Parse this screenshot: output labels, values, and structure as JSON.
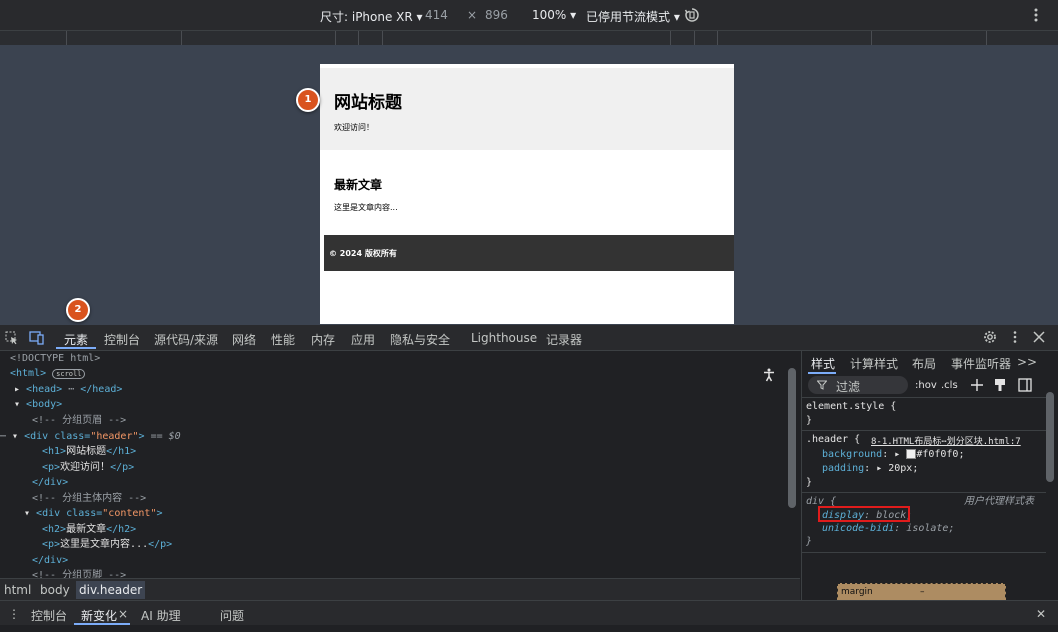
{
  "device_toolbar": {
    "dimensions_label": "尺寸: iPhone XR ▾",
    "width": "414",
    "times": "×",
    "height": "896",
    "zoom": "100% ▾",
    "throttle": "已停用节流模式 ▾"
  },
  "device_page": {
    "header_title": "网站标题",
    "header_text": "欢迎访问！",
    "article_title": "最新文章",
    "article_text": "这里是文章内容...",
    "footer_text": "© 2024 版权所有"
  },
  "badges": {
    "one": "1",
    "two": "2"
  },
  "devtools_tabs": [
    "元素",
    "控制台",
    "源代码/来源",
    "网络",
    "性能",
    "内存",
    "应用",
    "隐私与安全",
    "Lighthouse",
    "记录器"
  ],
  "elements_tree": {
    "doctype": "<!DOCTYPE html>",
    "html_open": "<html>",
    "scroll_badge": "scroll",
    "head": "<head>",
    "head_close": "</head>",
    "body_open": "<body>",
    "comment_header": "<!-- 分组页眉 -->",
    "div_header_tag": "<div class=",
    "div_header_class": "\"header\"",
    "selected_marker": "== $0",
    "h1_open": "<h1>",
    "h1_text": "网站标题",
    "h1_close": "</h1>",
    "p_open": "<p>",
    "p_text": "欢迎访问！",
    "p_close": "</p>",
    "div_close": "</div>",
    "comment_content": "<!-- 分组主体内容 -->",
    "div_content_class": "\"content\"",
    "h2_open": "<h2>",
    "h2_text": "最新文章",
    "h2_close": "</h2>",
    "p2_text": "这里是文章内容...",
    "comment_footer": "<!-- 分组页脚 -->"
  },
  "breadcrumbs": [
    "html",
    "body",
    "div.header"
  ],
  "styles_tabs": [
    "样式",
    "计算样式",
    "布局",
    "事件监听器",
    ">>"
  ],
  "styles": {
    "filter_placeholder": "过滤",
    "hov": ":hov",
    "cls": ".cls",
    "element_style": "element.style {",
    "close_brace": "}",
    "header_selector": ".header {",
    "header_source": "8-1.HTML布局标⋯划分区块.html:7",
    "background_prop": "background",
    "background_value": "#f0f0f0;",
    "padding_prop": "padding",
    "padding_value": "20px;",
    "div_selector": "div {",
    "ua_label": "用户代理样式表",
    "display_prop": "display",
    "display_value": "block;",
    "unicode_prop": "unicode-bidi",
    "unicode_value": "isolate;",
    "margin_label": "margin",
    "margin_value": "–"
  },
  "drawer_tabs": [
    "控制台",
    "新变化",
    "AI 助理",
    "问题"
  ],
  "colors": {
    "accent": "#7cacf8",
    "badge": "#d9531e",
    "highlight_box": "#e01c1c",
    "header_bg": "#f0f0f0",
    "footer_bg": "#333333"
  }
}
